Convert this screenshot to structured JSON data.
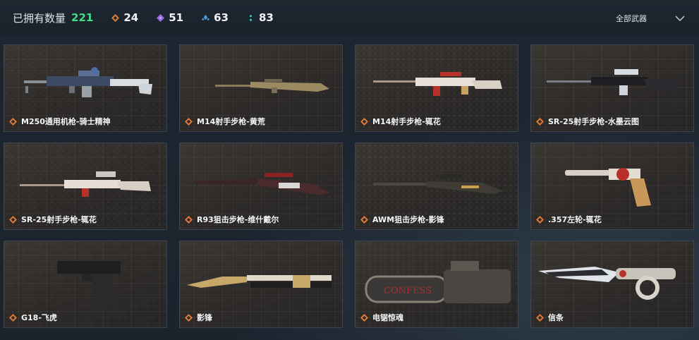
{
  "header": {
    "owned_label": "已拥有数量",
    "owned_count": "221",
    "stats": [
      {
        "icon": "orange-diamond-icon",
        "color": "#e07a36",
        "value": "24"
      },
      {
        "icon": "purple-diamond-icon",
        "color": "#9a6ae8",
        "value": "51"
      },
      {
        "icon": "blue-diamond-icon",
        "color": "#4a9ee6",
        "value": "63"
      },
      {
        "icon": "teal-dots-icon",
        "color": "#3fd0c4",
        "value": "83"
      }
    ],
    "filter_label": "全部武器"
  },
  "weapons": [
    {
      "name": "M250通用机枪-骑士精神",
      "icon": "machine-gun-icon"
    },
    {
      "name": "M14射手步枪-黄荒",
      "icon": "rifle-icon"
    },
    {
      "name": "M14射手步枪-辄花",
      "icon": "rifle-icon"
    },
    {
      "name": "SR-25射手步枪-水墨云图",
      "icon": "rifle-icon"
    },
    {
      "name": "SR-25射手步枪-辄花",
      "icon": "rifle-icon"
    },
    {
      "name": "R93狙击步枪-维什戴尔",
      "icon": "sniper-rifle-icon"
    },
    {
      "name": "AWM狙击步枪-影锋",
      "icon": "sniper-rifle-icon"
    },
    {
      "name": ".357左轮-辄花",
      "icon": "revolver-icon"
    },
    {
      "name": "G18-飞虎",
      "icon": "pistol-icon"
    },
    {
      "name": "影锋",
      "icon": "butterfly-knife-icon"
    },
    {
      "name": "电锯惊魂",
      "icon": "chainsaw-icon"
    },
    {
      "name": "信条",
      "icon": "knife-icon"
    }
  ],
  "colors": {
    "accent_green": "#3ee08a",
    "rarity_orange": "#e07a36"
  }
}
